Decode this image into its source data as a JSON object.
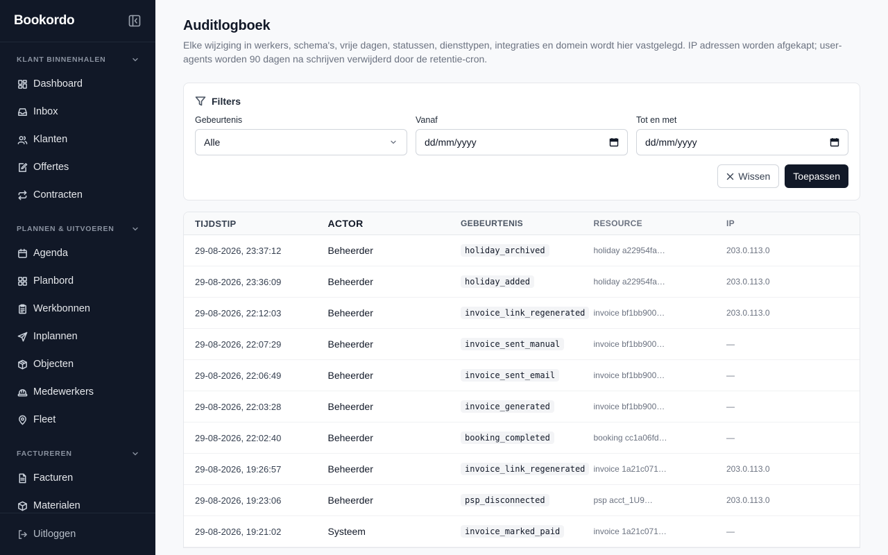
{
  "app": {
    "brand": "Bookordo"
  },
  "sidebar": {
    "sections": [
      {
        "title": "KLANT BINNENHALEN",
        "items": [
          {
            "label": "Dashboard",
            "icon": "dashboard-icon"
          },
          {
            "label": "Inbox",
            "icon": "inbox-icon"
          },
          {
            "label": "Klanten",
            "icon": "users-icon"
          },
          {
            "label": "Offertes",
            "icon": "quote-icon"
          },
          {
            "label": "Contracten",
            "icon": "contract-icon"
          }
        ]
      },
      {
        "title": "PLANNEN & UITVOEREN",
        "items": [
          {
            "label": "Agenda",
            "icon": "calendar-icon"
          },
          {
            "label": "Planbord",
            "icon": "board-icon"
          },
          {
            "label": "Werkbonnen",
            "icon": "clipboard-icon"
          },
          {
            "label": "Inplannen",
            "icon": "send-icon"
          },
          {
            "label": "Objecten",
            "icon": "package-icon"
          },
          {
            "label": "Medewerkers",
            "icon": "hardhat-icon"
          },
          {
            "label": "Fleet",
            "icon": "map-pin-icon"
          }
        ]
      },
      {
        "title": "FACTUREREN",
        "items": [
          {
            "label": "Facturen",
            "icon": "invoice-icon"
          },
          {
            "label": "Materialen",
            "icon": "box-icon"
          }
        ]
      }
    ],
    "logout": "Uitloggen"
  },
  "page": {
    "title": "Auditlogboek",
    "description": "Elke wijziging in werkers, schema's, vrije dagen, statussen, diensttypen, integraties en domein wordt hier vastgelegd. IP adressen worden afgekapt; user-agents worden 90 dagen na schrijven verwijderd door de retentie-cron."
  },
  "filters": {
    "title": "Filters",
    "event_label": "Gebeurtenis",
    "event_value": "Alle",
    "from_label": "Vanaf",
    "from_placeholder": "dd/mm/yyyy",
    "to_label": "Tot en met",
    "to_placeholder": "dd/mm/yyyy",
    "clear_label": "Wissen",
    "apply_label": "Toepassen"
  },
  "table": {
    "columns": [
      "TIJDSTIP",
      "ACTOR",
      "GEBEURTENIS",
      "RESOURCE",
      "IP"
    ],
    "rows": [
      {
        "time": "29-08-2026, 23:37:12",
        "actor": "Beheerder",
        "event": "holiday_archived",
        "resource": "holiday a22954fa…",
        "ip": "203.0.113.0"
      },
      {
        "time": "29-08-2026, 23:36:09",
        "actor": "Beheerder",
        "event": "holiday_added",
        "resource": "holiday a22954fa…",
        "ip": "203.0.113.0"
      },
      {
        "time": "29-08-2026, 22:12:03",
        "actor": "Beheerder",
        "event": "invoice_link_regenerated",
        "resource": "invoice bf1bb900…",
        "ip": "203.0.113.0"
      },
      {
        "time": "29-08-2026, 22:07:29",
        "actor": "Beheerder",
        "event": "invoice_sent_manual",
        "resource": "invoice bf1bb900…",
        "ip": "—"
      },
      {
        "time": "29-08-2026, 22:06:49",
        "actor": "Beheerder",
        "event": "invoice_sent_email",
        "resource": "invoice bf1bb900…",
        "ip": "—"
      },
      {
        "time": "29-08-2026, 22:03:28",
        "actor": "Beheerder",
        "event": "invoice_generated",
        "resource": "invoice bf1bb900…",
        "ip": "—"
      },
      {
        "time": "29-08-2026, 22:02:40",
        "actor": "Beheerder",
        "event": "booking_completed",
        "resource": "booking cc1a06fd…",
        "ip": "—"
      },
      {
        "time": "29-08-2026, 19:26:57",
        "actor": "Beheerder",
        "event": "invoice_link_regenerated",
        "resource": "invoice 1a21c071…",
        "ip": "203.0.113.0"
      },
      {
        "time": "29-08-2026, 19:23:06",
        "actor": "Beheerder",
        "event": "psp_disconnected",
        "resource": "psp acct_1U9…",
        "ip": "203.0.113.0"
      },
      {
        "time": "29-08-2026, 19:21:02",
        "actor": "Systeem",
        "event": "invoice_marked_paid",
        "resource": "invoice 1a21c071…",
        "ip": "—"
      }
    ]
  }
}
